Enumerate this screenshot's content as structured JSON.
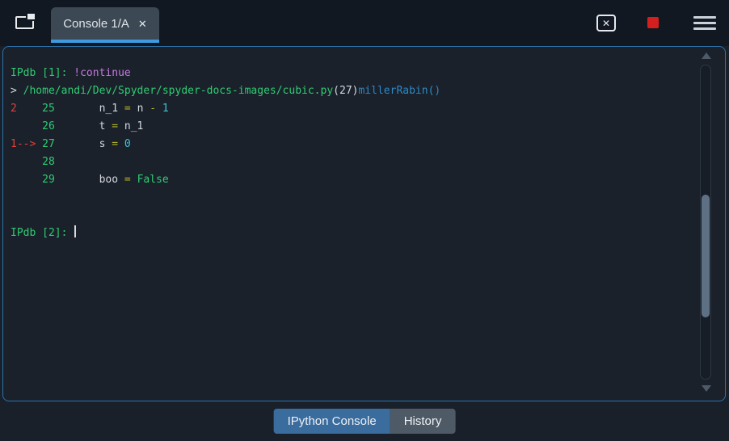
{
  "top_bar": {
    "tab": {
      "label": "Console 1/A",
      "close_glyph": "✕"
    },
    "close_box_glyph": "✕",
    "icons": {
      "browse_tabs": "browse-tabs-icon",
      "close_console": "close-box-icon",
      "interrupt_kernel": "stop-square-icon",
      "options_menu": "hamburger-menu-icon"
    }
  },
  "colors": {
    "accent_blue": "#3d9ce1",
    "frame_border": "#2d72a9",
    "stop_red": "#d41f1f",
    "prompt_green": "#2ecc71",
    "keyword_purple": "#c678dd",
    "breakpoint_red": "#e0403a",
    "operator_olive": "#b1b52c",
    "number_cyan": "#3fc5d5",
    "function_blue": "#2d87c4",
    "console_bg": "#1b212b"
  },
  "console": {
    "lines": [
      {
        "segments": [
          {
            "text": "IPdb [1]: ",
            "style": "green"
          },
          {
            "text": "!continue",
            "style": "purple"
          }
        ]
      },
      {
        "segments": [
          {
            "text": "> ",
            "style": "fg"
          },
          {
            "text": "/home/andi/Dev/Spyder/spyder-docs-images/cubic.py",
            "style": "green"
          },
          {
            "text": "(27)",
            "style": "fg"
          },
          {
            "text": "millerRabin()",
            "style": "blue"
          }
        ]
      },
      {
        "segments": [
          {
            "text": "2",
            "style": "red"
          },
          {
            "text": "    ",
            "style": "fg"
          },
          {
            "text": "25",
            "style": "green"
          },
          {
            "text": "       ",
            "style": "fg"
          },
          {
            "text": "n_1 ",
            "style": "fg"
          },
          {
            "text": "= ",
            "style": "olive"
          },
          {
            "text": "n ",
            "style": "fg"
          },
          {
            "text": "- ",
            "style": "olive"
          },
          {
            "text": "1",
            "style": "cyan"
          }
        ]
      },
      {
        "segments": [
          {
            "text": "     ",
            "style": "fg"
          },
          {
            "text": "26",
            "style": "green"
          },
          {
            "text": "       ",
            "style": "fg"
          },
          {
            "text": "t ",
            "style": "fg"
          },
          {
            "text": "= ",
            "style": "olive"
          },
          {
            "text": "n_1",
            "style": "fg"
          }
        ]
      },
      {
        "segments": [
          {
            "text": "1-->",
            "style": "red"
          },
          {
            "text": " ",
            "style": "fg"
          },
          {
            "text": "27",
            "style": "green"
          },
          {
            "text": "       ",
            "style": "fg"
          },
          {
            "text": "s ",
            "style": "fg"
          },
          {
            "text": "= ",
            "style": "olive"
          },
          {
            "text": "0",
            "style": "cyan"
          }
        ]
      },
      {
        "segments": [
          {
            "text": "     ",
            "style": "fg"
          },
          {
            "text": "28",
            "style": "green"
          }
        ]
      },
      {
        "segments": [
          {
            "text": "     ",
            "style": "fg"
          },
          {
            "text": "29",
            "style": "green"
          },
          {
            "text": "       ",
            "style": "fg"
          },
          {
            "text": "boo ",
            "style": "fg"
          },
          {
            "text": "= ",
            "style": "olive"
          },
          {
            "text": "False",
            "style": "green"
          }
        ]
      },
      {
        "segments": []
      },
      {
        "segments": []
      },
      {
        "segments": [
          {
            "text": "IPdb [2]: ",
            "style": "green"
          }
        ],
        "cursor": true
      }
    ]
  },
  "bottom_tabs": [
    {
      "label": "IPython Console",
      "active": true
    },
    {
      "label": "History",
      "active": false
    }
  ]
}
